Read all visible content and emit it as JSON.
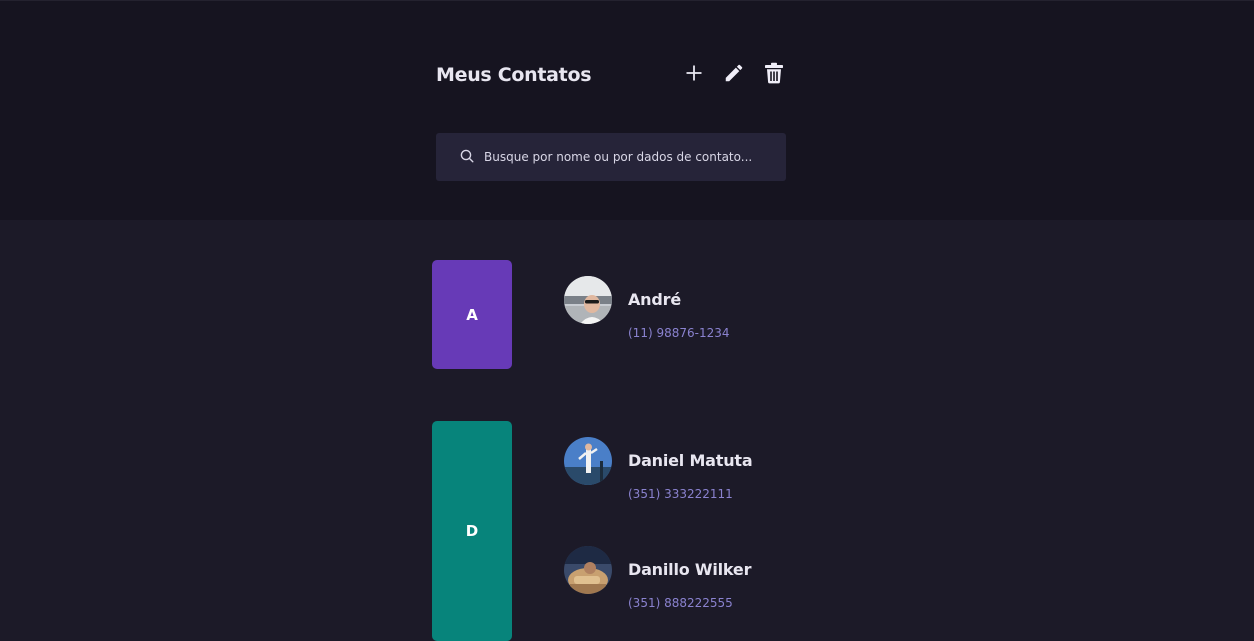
{
  "header": {
    "title": "Meus Contatos",
    "actions": [
      {
        "icon": "plus-icon"
      },
      {
        "icon": "pencil-icon"
      },
      {
        "icon": "trash-icon"
      }
    ]
  },
  "search": {
    "placeholder": "Busque por nome ou por dados de contato...",
    "value": ""
  },
  "groups": [
    {
      "letter": "A",
      "color": "#673ab7",
      "contacts": [
        {
          "name": "André",
          "phone": "(11) 98876-1234"
        }
      ]
    },
    {
      "letter": "D",
      "color": "#07847b",
      "contacts": [
        {
          "name": "Daniel Matuta",
          "phone": "(351) 333222111"
        },
        {
          "name": "Danillo Wilker",
          "phone": "(351) 888222555"
        }
      ]
    }
  ],
  "colors": {
    "header_bg": "#161420",
    "page_bg": "#1c1a28",
    "search_bg": "#262439",
    "phone_text": "#8a82cf"
  }
}
